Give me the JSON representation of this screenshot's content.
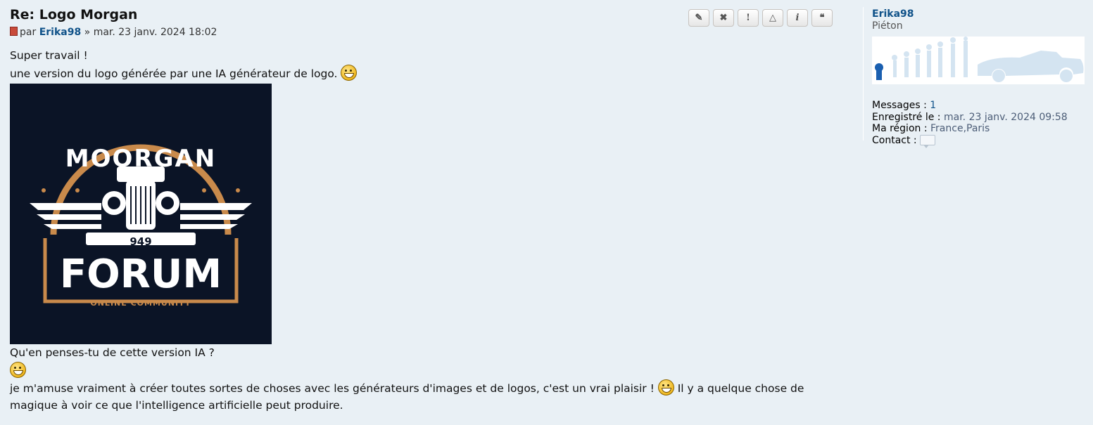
{
  "post": {
    "title": "Re: Logo Morgan",
    "by_prefix": "par",
    "author": "Erika98",
    "date_sep": "»",
    "date": "mar. 23 janv. 2024 18:02",
    "lines": [
      "Super travail !",
      "une version du logo générée par une IA générateur de logo.",
      "Qu'en penses-tu de cette version IA ?",
      "je m'amuse vraiment à créer toutes sortes de choses avec les générateurs d'images et de logos, c'est un vrai plaisir !",
      "Il y a quelque chose de",
      "magique à voir ce que l'intelligence artificielle peut produire."
    ],
    "logo_image": {
      "line1": "MOORGAN",
      "plate": "949",
      "line2": "FORUM",
      "line3": "ONLINE COMMUNITY"
    }
  },
  "buttons": [
    {
      "name": "edit-button",
      "icon": "pencil-icon",
      "glyph": "✎"
    },
    {
      "name": "delete-button",
      "icon": "x-icon",
      "glyph": "✖"
    },
    {
      "name": "report-button",
      "icon": "exclamation-icon",
      "glyph": "!"
    },
    {
      "name": "warn-button",
      "icon": "triangle-icon",
      "glyph": "△"
    },
    {
      "name": "info-button",
      "icon": "info-icon",
      "glyph": "i"
    },
    {
      "name": "quote-button",
      "icon": "quote-icon",
      "glyph": "❝"
    }
  ],
  "profile": {
    "username": "Erika98",
    "rank": "Piéton",
    "messages_label": "Messages :",
    "messages_value": "1",
    "registered_label": "Enregistré le :",
    "registered_value": "mar. 23 janv. 2024 09:58",
    "region_label": "Ma région :",
    "region_value": "France,Paris",
    "contact_label": "Contact :"
  },
  "colors": {
    "background": "#e9f0f5",
    "link": "#105289",
    "logo_bg": "#0b1426",
    "logo_accent": "#c98a4b"
  }
}
